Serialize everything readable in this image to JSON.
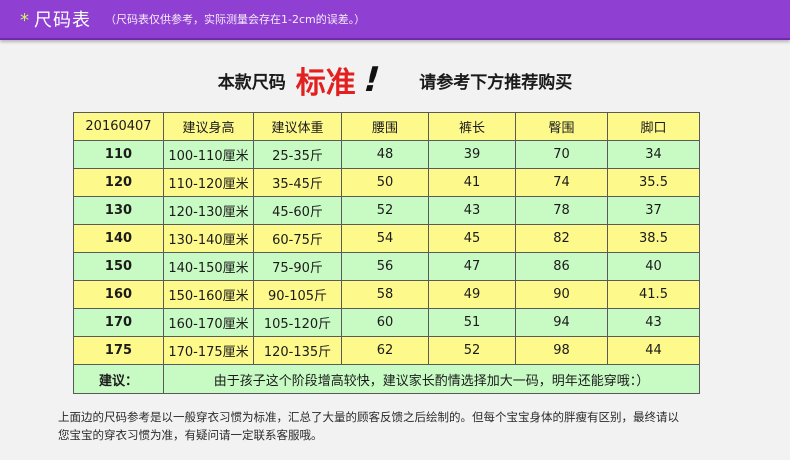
{
  "header": {
    "star": "*",
    "title": "尺码表",
    "note": "（尺码表仅供参考，实际测量会存在1-2cm的误差。）"
  },
  "banner": {
    "lead": "本款尺码",
    "emphasis": "标准",
    "exclaim": "!",
    "tail": "请参考下方推荐购买"
  },
  "table": {
    "headers": [
      "20160407",
      "建议身高",
      "建议体重",
      "腰围",
      "裤长",
      "臀围",
      "脚口"
    ],
    "rows": [
      {
        "size": "110",
        "height": "100-110厘米",
        "weight": "25-35斤",
        "waist": "48",
        "length": "39",
        "hip": "70",
        "hem": "34"
      },
      {
        "size": "120",
        "height": "110-120厘米",
        "weight": "35-45斤",
        "waist": "50",
        "length": "41",
        "hip": "74",
        "hem": "35.5"
      },
      {
        "size": "130",
        "height": "120-130厘米",
        "weight": "45-60斤",
        "waist": "52",
        "length": "43",
        "hip": "78",
        "hem": "37"
      },
      {
        "size": "140",
        "height": "130-140厘米",
        "weight": "60-75斤",
        "waist": "54",
        "length": "45",
        "hip": "82",
        "hem": "38.5"
      },
      {
        "size": "150",
        "height": "140-150厘米",
        "weight": "75-90斤",
        "waist": "56",
        "length": "47",
        "hip": "86",
        "hem": "40"
      },
      {
        "size": "160",
        "height": "150-160厘米",
        "weight": "90-105斤",
        "waist": "58",
        "length": "49",
        "hip": "90",
        "hem": "41.5"
      },
      {
        "size": "170",
        "height": "160-170厘米",
        "weight": "105-120斤",
        "waist": "60",
        "length": "51",
        "hip": "94",
        "hem": "43"
      },
      {
        "size": "175",
        "height": "170-175厘米",
        "weight": "120-135斤",
        "waist": "62",
        "length": "52",
        "hip": "98",
        "hem": "44"
      }
    ],
    "advice_label": "建议：",
    "advice_text": "由于孩子这个阶段增高较快，建议家长酌情选择加大一码，明年还能穿哦：）"
  },
  "footer": {
    "line1": "上面边的尺码参考是以一般穿衣习惯为标准，汇总了大量的顾客反馈之后绘制的。但每个宝宝身体的胖瘦有区别，最终请以",
    "line2": "您宝宝的穿衣习惯为准，有疑问请一定联系客服哦。"
  },
  "colors": {
    "header_bg": "#8f3fd1",
    "accent_red": "#e32020",
    "row_yellow": "#fdf98a",
    "row_green": "#c8fbc4"
  }
}
